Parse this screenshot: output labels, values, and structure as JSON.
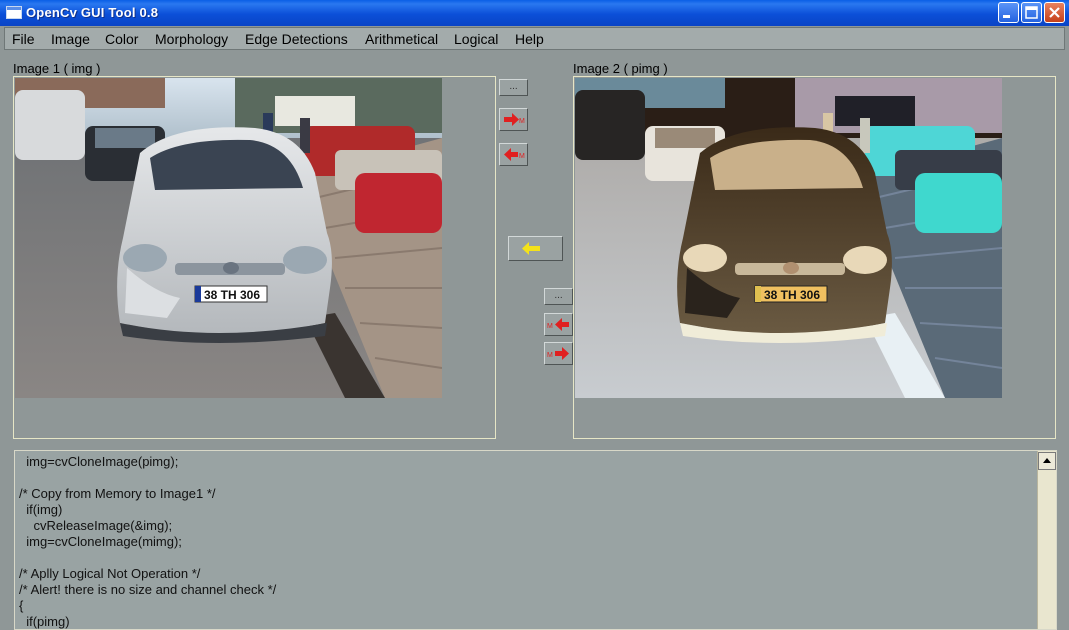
{
  "window": {
    "title": "OpenCv GUI Tool  0.8"
  },
  "menu": [
    "File",
    "Image",
    "Color",
    "Morphology",
    "Edge Detections",
    "Arithmetical",
    "Logical",
    "Help"
  ],
  "image1": {
    "label": "Image 1 ( img )",
    "plate": "38 TH 306"
  },
  "image2": {
    "label": "Image 2 ( pimg )",
    "plate": "38 TH 306"
  },
  "buttons": {
    "ellipsis_top": "...",
    "ellipsis_mid": "...",
    "m_label": "M"
  },
  "code": {
    "lines": [
      "  img=cvCloneImage(pimg);",
      "",
      "/* Copy from Memory to Image1 */",
      "  if(img)",
      "    cvReleaseImage(&img);",
      "  img=cvCloneImage(mimg);",
      "",
      "/* Aplly Logical Not Operation */",
      "/* Alert! there is no size and channel check */",
      "{",
      "  if(pimg)"
    ]
  },
  "colors": {
    "titlebar": "#0b4fd8",
    "background": "#8f9797",
    "arrow_red": "#e02020",
    "arrow_yellow": "#f4e21a"
  }
}
